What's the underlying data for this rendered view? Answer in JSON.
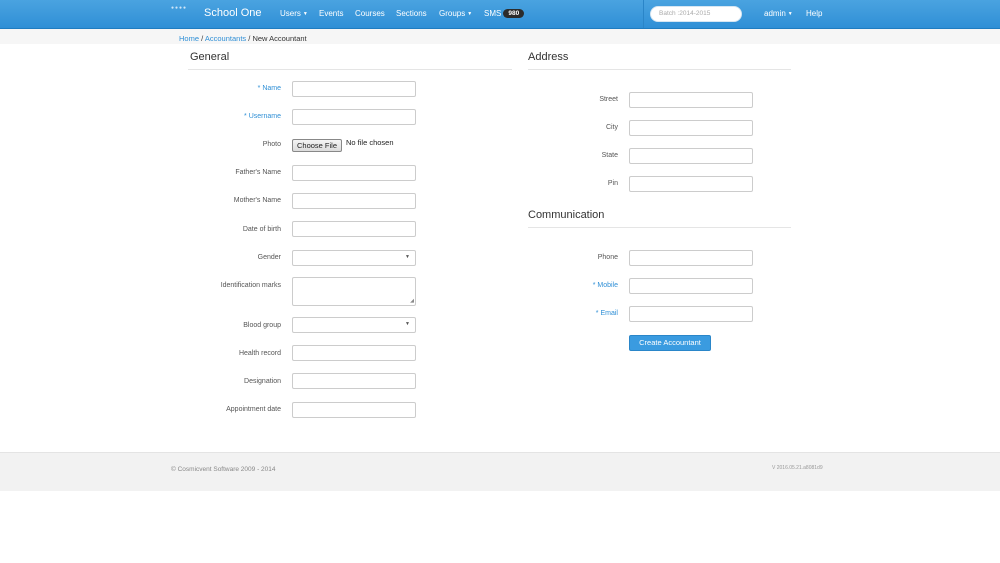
{
  "navbar": {
    "brand": "School One",
    "users": "Users",
    "events": "Events",
    "courses": "Courses",
    "sections": "Sections",
    "groups": "Groups",
    "sms": "SMS",
    "sms_count": "980",
    "batch": "Batch :2014-2015",
    "admin": "admin",
    "help": "Help"
  },
  "breadcrumb": {
    "home": "Home",
    "accountants": "Accountants",
    "current": "New Accountant"
  },
  "general": {
    "title": "General",
    "name_label": "Name",
    "username_label": "Username",
    "photo_label": "Photo",
    "choose_file": "Choose File",
    "no_file": "No file chosen",
    "father_label": "Father's Name",
    "mother_label": "Mother's Name",
    "dob_label": "Date of birth",
    "gender_label": "Gender",
    "ident_label": "Identification marks",
    "blood_label": "Blood group",
    "health_label": "Health record",
    "designation_label": "Designation",
    "appointment_label": "Appointment date"
  },
  "address": {
    "title": "Address",
    "street_label": "Street",
    "city_label": "City",
    "state_label": "State",
    "pin_label": "Pin"
  },
  "communication": {
    "title": "Communication",
    "phone_label": "Phone",
    "mobile_label": "Mobile",
    "email_label": "Email",
    "submit": "Create Accountant"
  },
  "required_marker": "*",
  "footer": {
    "copyright": "© Cosmicvent Software 2009 - 2014",
    "version": "V 2016.05.21.a8081d9"
  },
  "colors": {
    "accent": "#2f8fd6",
    "navbar": "#3a9be0",
    "badge": "#2c2c2c"
  }
}
